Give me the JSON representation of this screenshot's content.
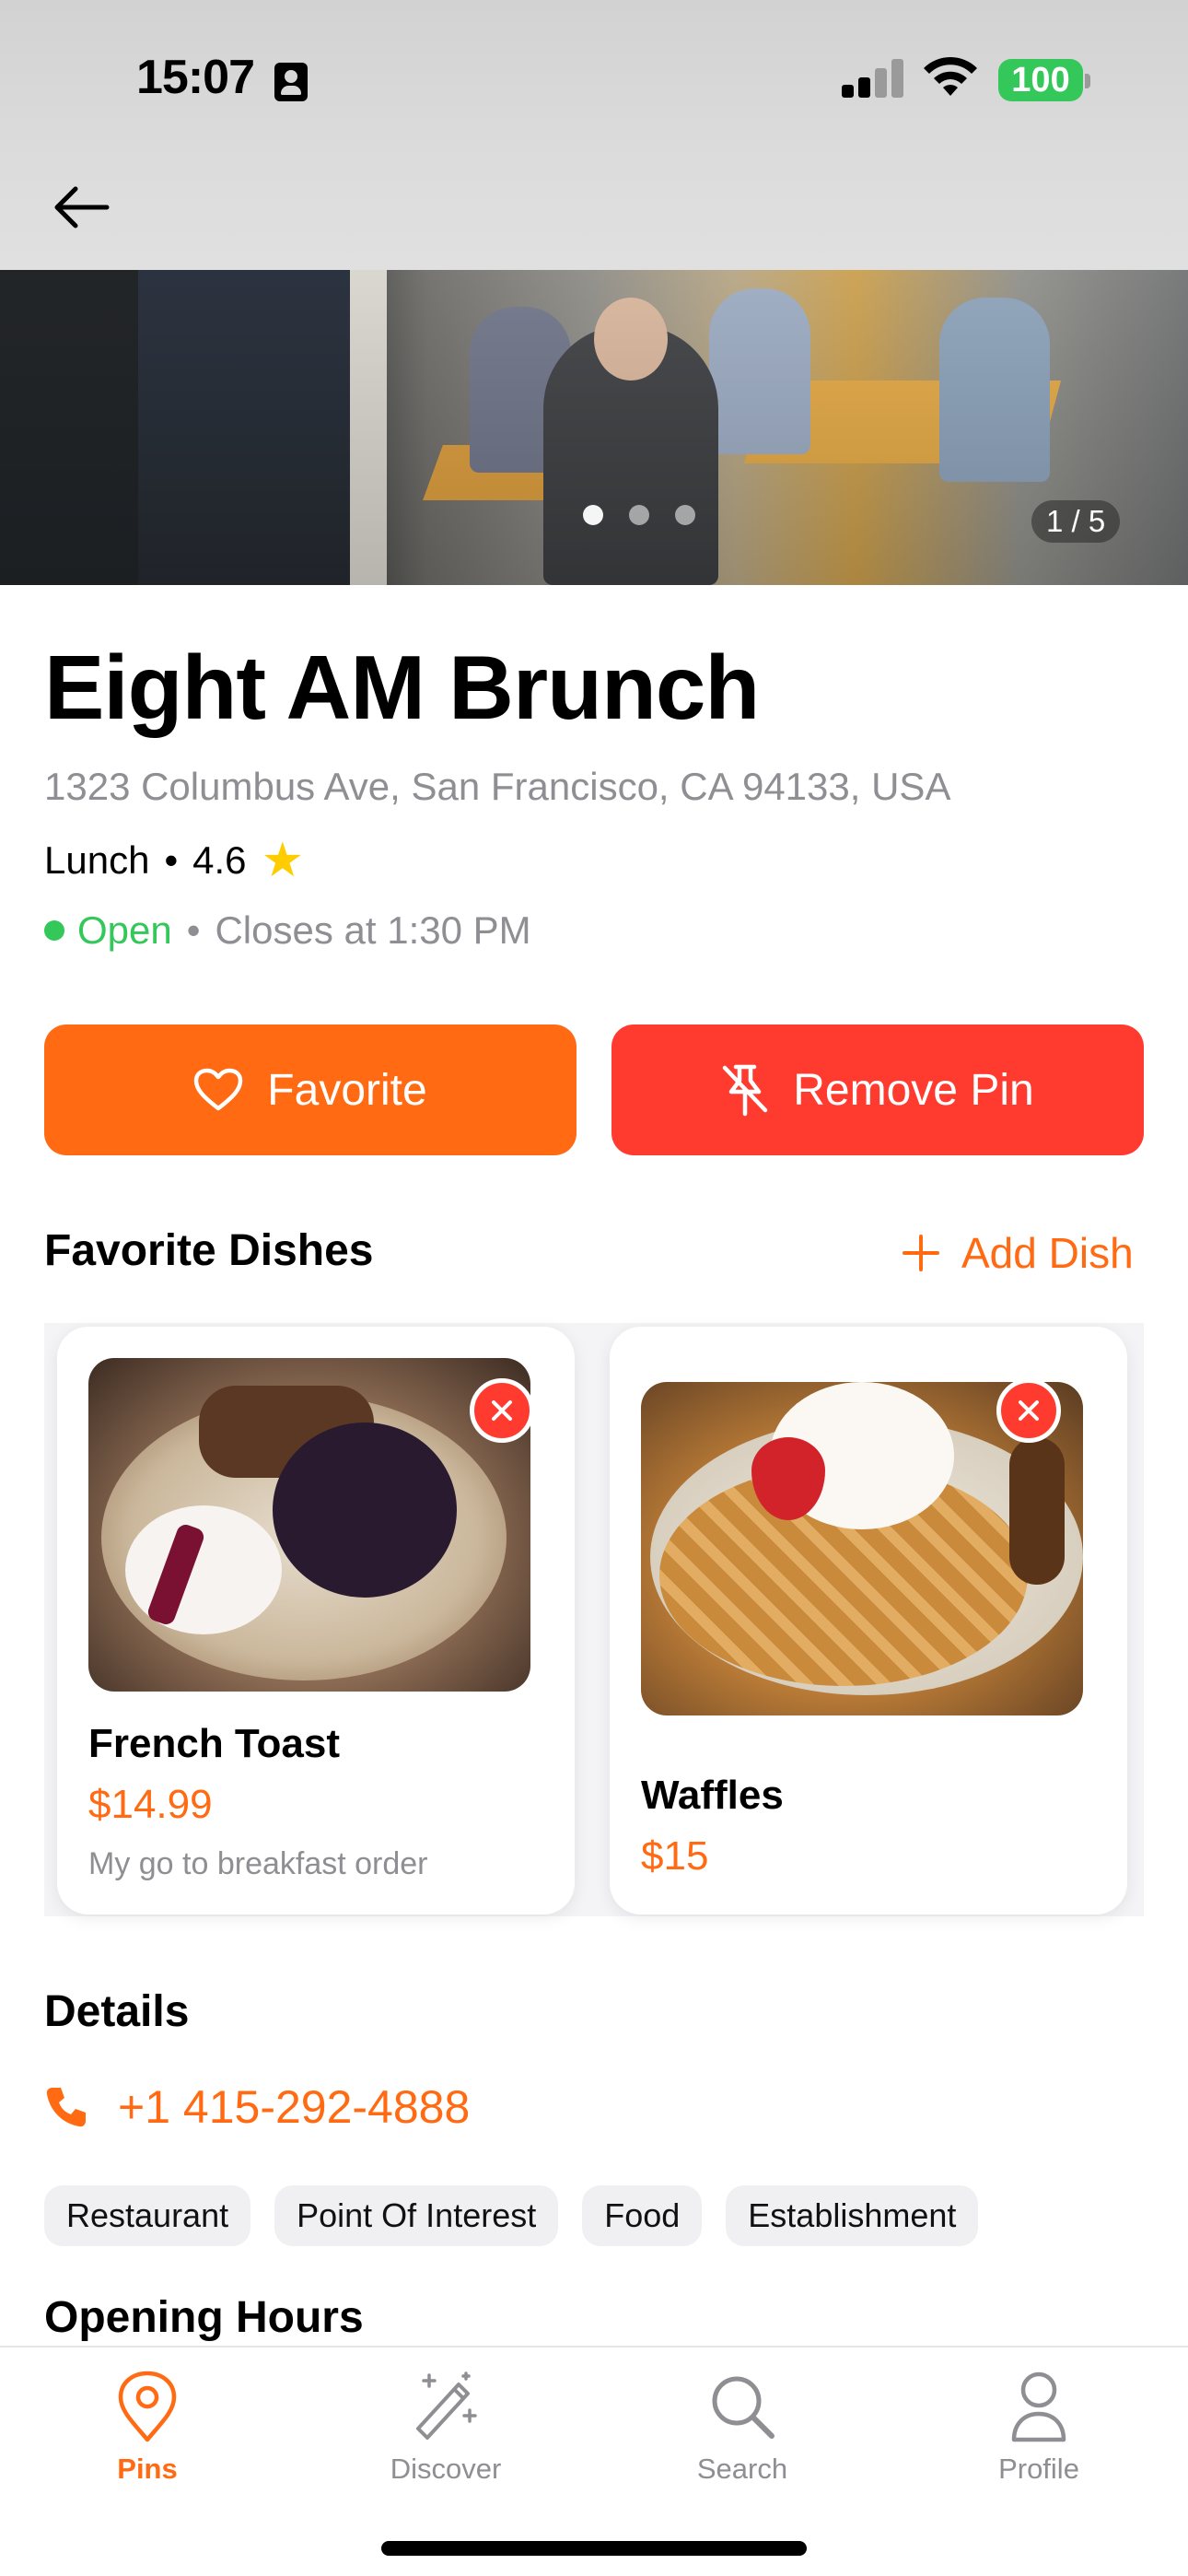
{
  "status_bar": {
    "time": "15:07",
    "battery": "100"
  },
  "gallery": {
    "counter": "1 / 5"
  },
  "place": {
    "name": "Eight AM Brunch",
    "address": "1323 Columbus Ave, San Francisco, CA 94133, USA",
    "category": "Lunch",
    "separator": "•",
    "rating": "4.6",
    "star": "★",
    "open_label": "Open",
    "close_text": "Closes at 1:30 PM"
  },
  "actions": {
    "favorite_label": "Favorite",
    "remove_pin_label": "Remove Pin"
  },
  "favorite_dishes": {
    "title": "Favorite Dishes",
    "add_label": "Add Dish",
    "items": [
      {
        "name": "French Toast",
        "price": "$14.99",
        "note": "My go to breakfast order"
      },
      {
        "name": "Waffles",
        "price": "$15"
      }
    ]
  },
  "details": {
    "title": "Details",
    "phone": "+1 415-292-4888",
    "tags": [
      "Restaurant",
      "Point Of Interest",
      "Food",
      "Establishment"
    ]
  },
  "opening_hours": {
    "title": "Opening Hours"
  },
  "tabbar": {
    "items": [
      {
        "label": "Pins",
        "icon": "pin-icon"
      },
      {
        "label": "Discover",
        "icon": "magic-wand-icon"
      },
      {
        "label": "Search",
        "icon": "search-icon"
      },
      {
        "label": "Profile",
        "icon": "person-icon"
      }
    ]
  },
  "colors": {
    "accent": "#ff6a13",
    "danger": "#ff3b30",
    "open": "#34c759",
    "secondary_text": "#8e8e93"
  }
}
